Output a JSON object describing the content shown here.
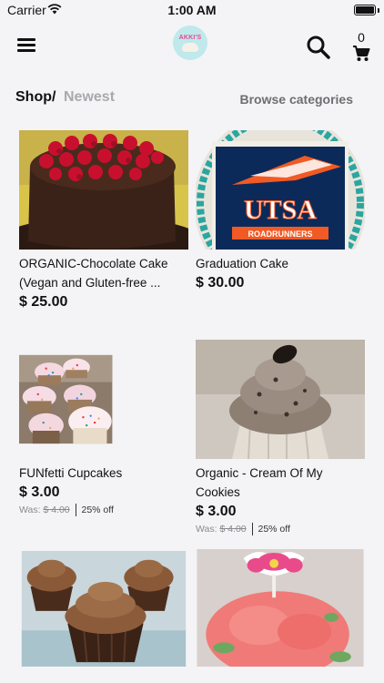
{
  "status_bar": {
    "carrier": "Carrier",
    "time": "1:00 AM"
  },
  "header": {
    "logo_text": "AKKI'S",
    "cart_count": "0"
  },
  "breadcrumb": {
    "shop": "Shop",
    "separator": "/",
    "current": "Newest",
    "browse_label": "Browse categories"
  },
  "products": [
    {
      "name": "ORGANIC-Chocolate Cake (Vegan and Gluten-free ...",
      "price": "$ 25.00",
      "was_label": "",
      "was_price": "",
      "discount": ""
    },
    {
      "name": "Graduation Cake",
      "price": "$ 30.00",
      "was_label": "",
      "was_price": "",
      "discount": ""
    },
    {
      "name": "FUNfetti Cupcakes",
      "price": "$ 3.00",
      "was_label": "Was:",
      "was_price": "$ 4.00",
      "discount": "25% off"
    },
    {
      "name": "Organic - Cream Of My Cookies",
      "price": "$ 3.00",
      "was_label": "Was:",
      "was_price": "$ 4.00",
      "discount": "25% off"
    },
    {
      "name": "",
      "price": ""
    },
    {
      "name": "",
      "price": ""
    }
  ],
  "graduation_cake_print": {
    "logo_text": "UTSA",
    "sub_text": "ROADRUNNERS"
  },
  "icons": {
    "menu": "hamburger-menu-icon",
    "search": "search-icon",
    "cart": "shopping-cart-icon",
    "wifi": "wifi-icon",
    "battery": "battery-icon"
  }
}
